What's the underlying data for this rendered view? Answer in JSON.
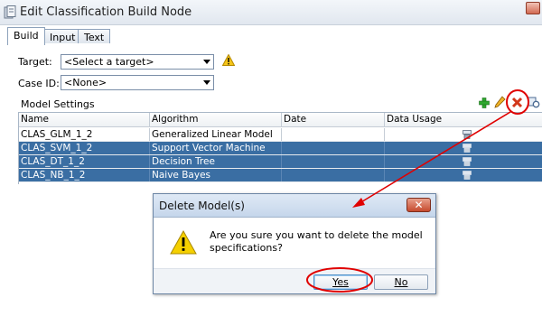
{
  "window": {
    "title": "Edit Classification Build Node"
  },
  "tabs": [
    {
      "label": "Build",
      "active": true
    },
    {
      "label": "Input",
      "active": false
    },
    {
      "label": "Text",
      "active": false
    }
  ],
  "form": {
    "target_label": "Target:",
    "target_value": "<Select a target>",
    "case_id_label": "Case ID:",
    "case_id_value": "<None>"
  },
  "model_settings": {
    "title": "Model Settings",
    "toolbar": [
      "add-icon",
      "edit-icon",
      "delete-icon",
      "compare-icon"
    ],
    "columns": [
      "Name",
      "Algorithm",
      "Date",
      "Data Usage"
    ],
    "rows": [
      {
        "name": "CLAS_GLM_1_2",
        "algorithm": "Generalized Linear Model",
        "date": "",
        "selected": false
      },
      {
        "name": "CLAS_SVM_1_2",
        "algorithm": "Support Vector Machine",
        "date": "",
        "selected": true
      },
      {
        "name": "CLAS_DT_1_2",
        "algorithm": "Decision Tree",
        "date": "",
        "selected": true
      },
      {
        "name": "CLAS_NB_1_2",
        "algorithm": "Naive Bayes",
        "date": "",
        "selected": true
      }
    ]
  },
  "dialog": {
    "title": "Delete Model(s)",
    "message": "Are you sure you want to delete the model specifications?",
    "yes_label": "Yes",
    "no_label": "No"
  },
  "colors": {
    "selection": "#3a6ea3",
    "annotation": "#e00000",
    "warning": "#f5c518",
    "add": "#2fa82f"
  }
}
